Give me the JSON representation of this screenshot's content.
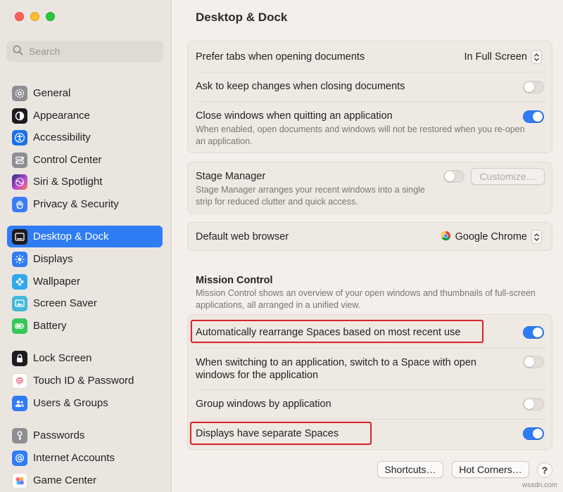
{
  "sidebar": {
    "search": {
      "placeholder": "Search",
      "icon": "magnifier-icon"
    },
    "groups": [
      [
        {
          "label": "General",
          "icon": "gear-icon",
          "color": "#8e8e93"
        },
        {
          "label": "Appearance",
          "icon": "appearance-icon",
          "color": "#1c1c1e"
        },
        {
          "label": "Accessibility",
          "icon": "accessibility-icon",
          "color": "#1a73e8"
        },
        {
          "label": "Control Center",
          "icon": "control-center-icon",
          "color": "#8e8e93"
        },
        {
          "label": "Siri & Spotlight",
          "icon": "siri-icon",
          "color": "#6e4ad9"
        },
        {
          "label": "Privacy & Security",
          "icon": "hand-icon",
          "color": "#3a7bf6"
        }
      ],
      [
        {
          "label": "Desktop & Dock",
          "icon": "desktop-dock-icon",
          "color": "#1c1c1e",
          "active": true
        },
        {
          "label": "Displays",
          "icon": "sun-icon",
          "color": "#2f7cf6"
        },
        {
          "label": "Wallpaper",
          "icon": "flower-icon",
          "color": "#30a8f0"
        },
        {
          "label": "Screen Saver",
          "icon": "screen-saver-icon",
          "color": "#43b8d8"
        },
        {
          "label": "Battery",
          "icon": "battery-icon",
          "color": "#34c759"
        }
      ],
      [
        {
          "label": "Lock Screen",
          "icon": "lock-icon",
          "color": "#1c1c1e"
        },
        {
          "label": "Touch ID & Password",
          "icon": "fingerprint-icon",
          "color": "#ffffff"
        },
        {
          "label": "Users & Groups",
          "icon": "users-icon",
          "color": "#2f7cf6"
        }
      ],
      [
        {
          "label": "Passwords",
          "icon": "key-icon",
          "color": "#8e8e93"
        },
        {
          "label": "Internet Accounts",
          "icon": "at-icon",
          "color": "#2f7cf6"
        },
        {
          "label": "Game Center",
          "icon": "game-center-icon",
          "color": "#ff5f8a"
        }
      ]
    ]
  },
  "main": {
    "title": "Desktop & Dock",
    "windows": {
      "prefer_tabs_label": "Prefer tabs when opening documents",
      "prefer_tabs_value": "In Full Screen",
      "ask_keep_label": "Ask to keep changes when closing documents",
      "ask_keep_on": false,
      "close_windows_label": "Close windows when quitting an application",
      "close_windows_on": true,
      "close_windows_sub": "When enabled, open documents and windows will not be restored when you re-open an application."
    },
    "stage_manager": {
      "label": "Stage Manager",
      "on": false,
      "customize_label": "Customize…",
      "sub": "Stage Manager arranges your recent windows into a single strip for reduced clutter and quick access."
    },
    "browser": {
      "label": "Default web browser",
      "value": "Google Chrome",
      "icon": "chrome-icon"
    },
    "mission_control": {
      "title": "Mission Control",
      "sub": "Mission Control shows an overview of your open windows and thumbnails of full-screen applications, all arranged in a unified view.",
      "auto_rearrange_label": "Automatically rearrange Spaces based on most recent use",
      "auto_rearrange_on": true,
      "switch_space_label": "When switching to an application, switch to a Space with open windows for the application",
      "switch_space_on": false,
      "group_windows_label": "Group windows by application",
      "group_windows_on": false,
      "separate_spaces_label": "Displays have separate Spaces",
      "separate_spaces_on": true
    },
    "footer": {
      "shortcuts_label": "Shortcuts…",
      "hot_corners_label": "Hot Corners…",
      "help_label": "?"
    },
    "watermark": "wsxdn.com"
  }
}
